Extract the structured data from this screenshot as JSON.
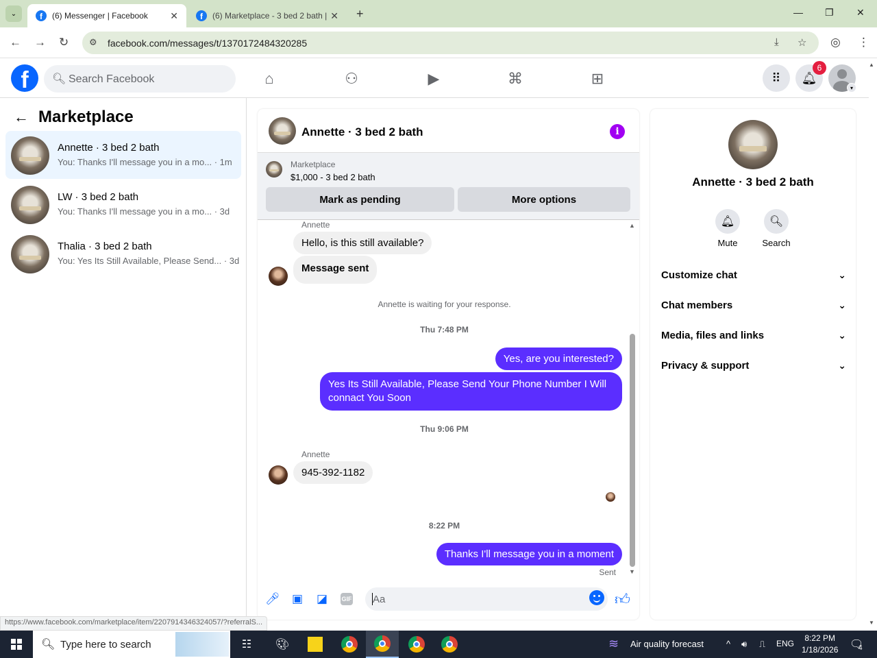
{
  "browser": {
    "tabs": [
      {
        "title": "(6) Messenger | Facebook",
        "active": true
      },
      {
        "title": "(6) Marketplace - 3 bed 2 bath |",
        "active": false
      }
    ],
    "new_tab": "+",
    "window_controls": {
      "minimize": "—",
      "restore": "❐",
      "close": "✕"
    },
    "url": "facebook.com/messages/t/1370172484320285"
  },
  "fb_header": {
    "logo": "f",
    "search_placeholder": "Search Facebook",
    "nav_icons": [
      "home-icon",
      "friends-icon",
      "video-icon",
      "marketplace-icon",
      "gaming-icon"
    ],
    "notification_count": "6"
  },
  "left_panel": {
    "title": "Marketplace",
    "conversations": [
      {
        "name": "Annette · 3 bed 2 bath",
        "snippet": "You: Thanks I'll message you in a mo...",
        "time": "· 1m",
        "selected": true
      },
      {
        "name": "LW · 3 bed 2 bath",
        "snippet": "You: Thanks I'll message you in a mo...",
        "time": "· 3d",
        "selected": false
      },
      {
        "name": "Thalia · 3 bed 2 bath",
        "snippet": "You: Yes Its Still Available, Please Send...",
        "time": "· 3d",
        "selected": false
      }
    ]
  },
  "chat": {
    "title": "Annette · 3 bed 2 bath",
    "listing": {
      "label": "Marketplace",
      "price_title": "$1,000 - 3 bed 2 bath",
      "mark_pending": "Mark as pending",
      "more_options": "More options"
    },
    "messages": {
      "sender1": "Annette",
      "in1": "Hello, is this still available?",
      "in2": "Message sent",
      "waiting_note": "Annette is waiting for your response.",
      "ts1": "Thu 7:48 PM",
      "out1": "Yes, are you interested?",
      "out2": "Yes Its Still Available, Please Send Your Phone Number I Will connact You Soon",
      "ts2": "Thu 9:06 PM",
      "sender2": "Annette",
      "in3": "945-392-1182",
      "ts3": "8:22 PM",
      "out3": "Thanks I'll message you in a moment",
      "status": "Sent"
    },
    "composer_placeholder": "Aa",
    "gif_label": "GIF"
  },
  "right_panel": {
    "name": "Annette · 3 bed 2 bath",
    "actions": [
      {
        "label": "Mute",
        "icon": "bell-icon"
      },
      {
        "label": "Search",
        "icon": "search-icon"
      }
    ],
    "sections": [
      "Customize chat",
      "Chat members",
      "Media, files and links",
      "Privacy & support"
    ]
  },
  "status_link": "https://www.facebook.com/marketplace/item/2207914346324057/?referralS...",
  "taskbar": {
    "search_placeholder": "Type here to search",
    "weather": "Air quality forecast",
    "language": "ENG",
    "time": "8:22 PM",
    "date": "1/18/2026",
    "notification_count": "4"
  },
  "colors": {
    "fb_blue": "#0866ff",
    "outgoing_bubble": "#5b2eff",
    "info_purple": "#a100f2",
    "selected_conv": "#ebf5ff",
    "badge_red": "#e41e3f"
  }
}
